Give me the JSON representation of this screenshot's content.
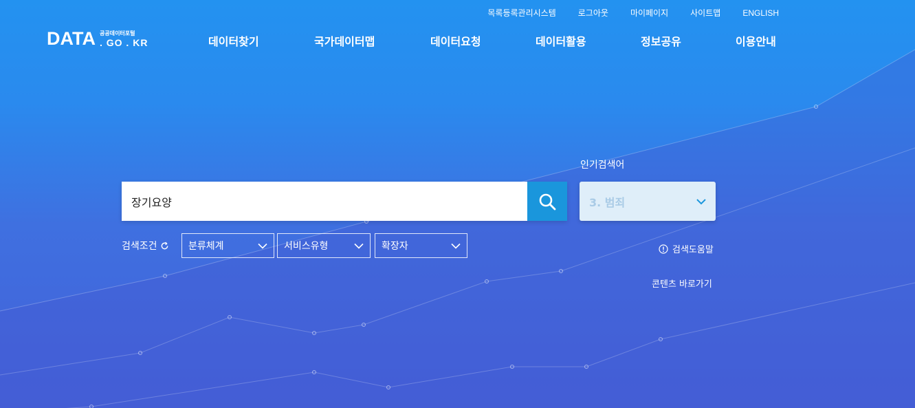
{
  "util_nav": [
    "목록등록관리시스템",
    "로그아웃",
    "마이페이지",
    "사이트맵",
    "ENGLISH"
  ],
  "logo": {
    "main": "DATA",
    "sub": "공공데이터포털",
    "domain": ". GO . KR"
  },
  "main_nav": [
    "데이터찾기",
    "국가데이터맵",
    "데이터요청",
    "데이터활용",
    "정보공유",
    "이용안내"
  ],
  "search": {
    "value": "장기요양",
    "button_icon": "search-icon"
  },
  "popular": {
    "label": "인기검색어",
    "selected": "3. 범죄"
  },
  "conditions": {
    "label": "검색조건",
    "filters": [
      "분류체계",
      "서비스유형",
      "확장자"
    ]
  },
  "help_label": "검색도움말",
  "contents_link": "콘텐츠 바로가기",
  "colors": {
    "accent": "#1a96dc",
    "bg_top": "#2392f0",
    "bg_bottom": "#4460d8"
  }
}
